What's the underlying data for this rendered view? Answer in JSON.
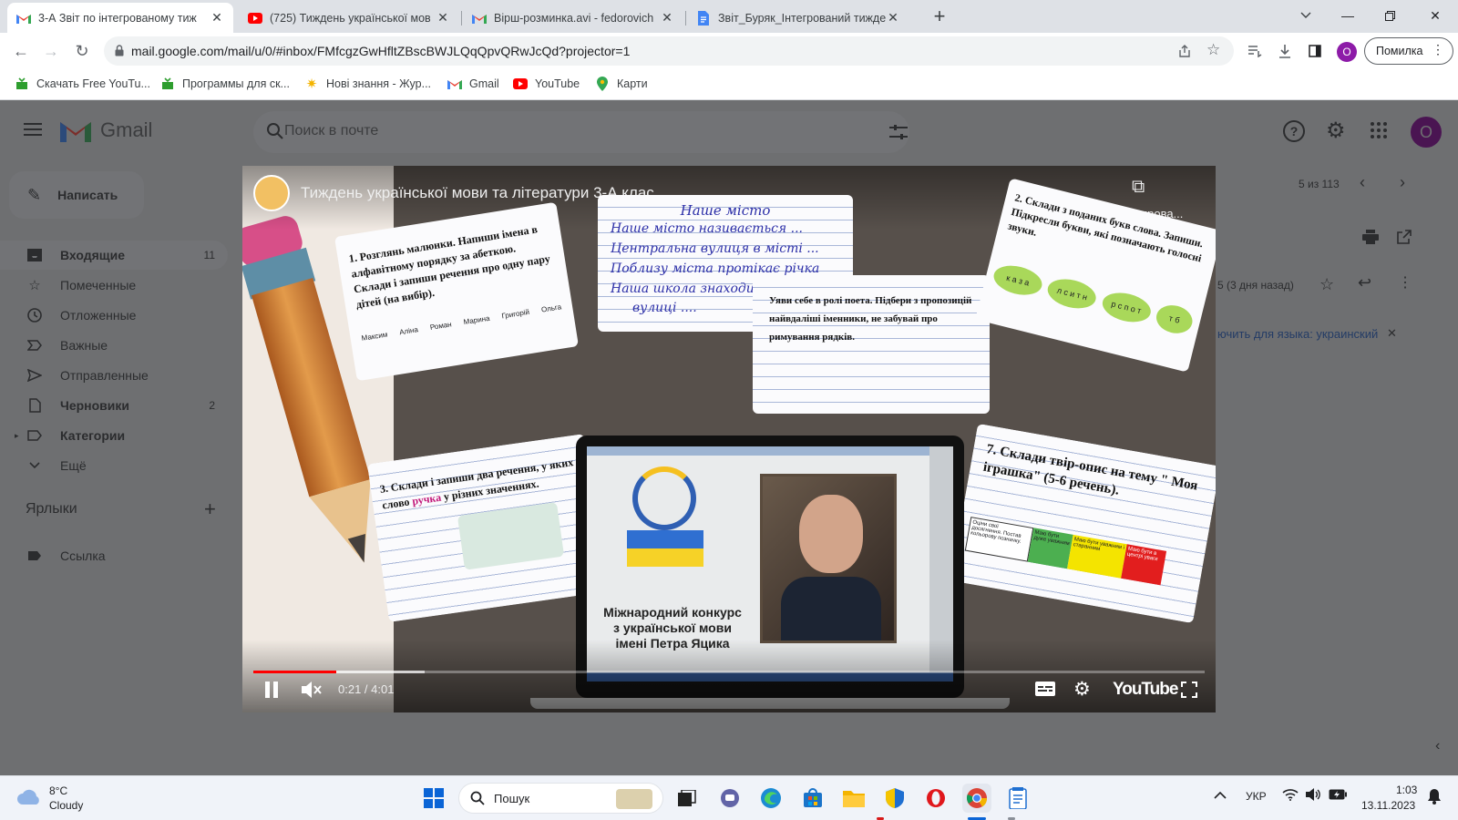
{
  "browser": {
    "tabs": [
      {
        "title": "3-А Звіт по інтегрованому тиж",
        "icon": "gmail-icon",
        "active": true
      },
      {
        "title": "(725) Тиждень української мов",
        "icon": "youtube-icon",
        "active": false
      },
      {
        "title": "Вірш-розминка.avi - fedorovich",
        "icon": "gmail-icon",
        "active": false
      },
      {
        "title": "Звіт_Буряк_Інтегрований тижде",
        "icon": "docs-icon",
        "active": false
      }
    ],
    "url": "mail.google.com/mail/u/0/#inbox/FMfcgzGwHfltZBscBWJLQqQpvQRwJcQd?projector=1",
    "profile_initial": "О",
    "error_label": "Помилка",
    "bookmarks": [
      {
        "label": "Скачать Free YouTu...",
        "icon": "green-download-icon"
      },
      {
        "label": "Программы для ск...",
        "icon": "green-download-icon"
      },
      {
        "label": "Нові знання - Жур...",
        "icon": "sun-icon"
      },
      {
        "label": "Gmail",
        "icon": "gmail-icon"
      },
      {
        "label": "YouTube",
        "icon": "youtube-icon"
      },
      {
        "label": "Карти",
        "icon": "maps-pin-icon"
      }
    ]
  },
  "gmail": {
    "logo_text": "Gmail",
    "search_placeholder": "Поиск в почте",
    "compose": "Написать",
    "account_initial": "О",
    "nav": [
      {
        "label": "Входящие",
        "count": "11",
        "icon": "inbox-icon",
        "bold": true
      },
      {
        "label": "Помеченные",
        "count": "",
        "icon": "star-icon",
        "bold": false
      },
      {
        "label": "Отложенные",
        "count": "",
        "icon": "clock-icon",
        "bold": false
      },
      {
        "label": "Важные",
        "count": "",
        "icon": "important-icon",
        "bold": false
      },
      {
        "label": "Отправленные",
        "count": "",
        "icon": "send-icon",
        "bold": false
      },
      {
        "label": "Черновики",
        "count": "2",
        "icon": "draft-icon",
        "bold": true
      },
      {
        "label": "Категории",
        "count": "",
        "icon": "label-icon",
        "bold": true
      },
      {
        "label": "Ещё",
        "count": "",
        "icon": "chevron-down-icon",
        "bold": false
      }
    ],
    "labels_heading": "Ярлыки",
    "labels": [
      {
        "label": "Ссылка"
      }
    ],
    "pagination": "5 из 113",
    "date_text": "5 (3 дня назад)",
    "translate_text": "ючить для языка: украинский"
  },
  "video": {
    "title": "Тиждень української мови та літератури 3-А клас",
    "copy_label": "Копирова...",
    "time": "0:21 / 4:01",
    "progress": 0.087,
    "buffered": 0.18,
    "youtube_label": "YouTube",
    "note1": "1. Розглянь малюнки. Напиши імена в алфавітному порядку за абеткою. Склади і запиши речення про одну пару дітей (на вибір).",
    "kids": [
      "Максим",
      "Аліна",
      "Роман",
      "Марина",
      "Григорій",
      "Ольга"
    ],
    "note2_title": "Наше місто",
    "note2_lines": [
      "Наше місто називається ...",
      "Центральна вулиця в місті ...",
      "Поблизу міста протікає річка",
      "Наша школа знаходиться на",
      "вулиці ...."
    ],
    "note3": "Уяви себе в ролі поета. Підбери з пропозицій найвдаліші іменники, не забувай про римування рядків.",
    "note4": "2. Склади з поданих букв слова. Запиши. Підкресли букви, які позначають голосні звуки.",
    "leaf_letters": [
      "к а з а",
      "л с и т н",
      "р с п о т",
      "т б"
    ],
    "note5_prefix": "3. Склади і запиши два речення, у яких слово",
    "note5_word": "ручка",
    "note5_suffix": "у різних значеннях.",
    "note6": "7. Склади твір-опис на тему \" Моя іграшка\" (5-6 речень).",
    "note6_table": [
      "Оціни свої досягнення. Постав кольорову позначку.",
      "Маю бути дуже уважним",
      "Маю бути уважним і старанним",
      "Маю бути в центрі уваги"
    ],
    "laptop_caption": [
      "Міжнародний конкурс",
      "з української мови",
      "імені Петра Яцика"
    ]
  },
  "taskbar": {
    "temperature": "8°C",
    "weather": "Cloudy",
    "search_label": "Пошук",
    "language": "УКР",
    "time": "1:03",
    "date": "13.11.2023"
  }
}
